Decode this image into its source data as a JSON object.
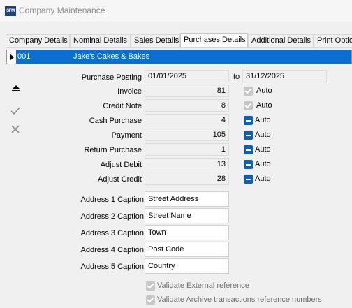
{
  "window": {
    "title": "Company Maintenance",
    "app_icon_text": "SFM"
  },
  "tabs": [
    {
      "label": "Company Details"
    },
    {
      "label": "Nominal Details"
    },
    {
      "label": "Sales Details"
    },
    {
      "label": "Purchases Details",
      "active": true
    },
    {
      "label": "Additional Details"
    },
    {
      "label": "Print Options"
    }
  ],
  "grid": {
    "code": "001",
    "name": "Jake's Cakes & Bakes"
  },
  "side_icons": [
    "move-up-icon",
    "confirm-check-icon",
    "cancel-x-icon"
  ],
  "purchase_posting": {
    "label": "Purchase Posting",
    "from": "01/01/2025",
    "to_label": "to",
    "to": "31/12/2025"
  },
  "sequences": [
    {
      "label": "Invoice",
      "value": "81",
      "auto_label": "Auto",
      "auto_state": "checked-disabled"
    },
    {
      "label": "Credit Note",
      "value": "8",
      "auto_label": "Auto",
      "auto_state": "checked-disabled"
    },
    {
      "label": "Cash Purchase",
      "value": "4",
      "auto_label": "Auto",
      "auto_state": "indeterminate"
    },
    {
      "label": "Payment",
      "value": "105",
      "auto_label": "Auto",
      "auto_state": "indeterminate"
    },
    {
      "label": "Return Purchase",
      "value": "1",
      "auto_label": "Auto",
      "auto_state": "indeterminate"
    },
    {
      "label": "Adjust Debit",
      "value": "13",
      "auto_label": "Auto",
      "auto_state": "indeterminate"
    },
    {
      "label": "Adjust Credit",
      "value": "28",
      "auto_label": "Auto",
      "auto_state": "indeterminate"
    }
  ],
  "address_captions": [
    {
      "label": "Address 1 Caption",
      "value": "Street Address"
    },
    {
      "label": "Address 2 Caption",
      "value": "Street Name"
    },
    {
      "label": "Address 3 Caption",
      "value": "Town"
    },
    {
      "label": "Address 4 Caption",
      "value": "Post Code"
    },
    {
      "label": "Address 5 Caption",
      "value": "Country"
    }
  ],
  "options": [
    {
      "label": "Validate External reference",
      "state": "checked-disabled"
    },
    {
      "label": "Validate Archive transactions reference numbers",
      "state": "checked-disabled"
    }
  ]
}
